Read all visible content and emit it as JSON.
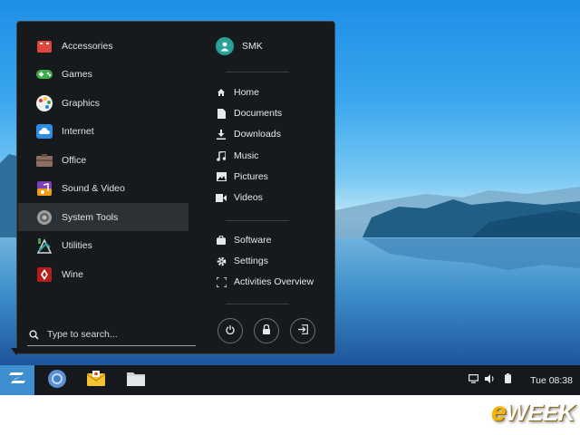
{
  "menu": {
    "categories": [
      {
        "label": "Accessories",
        "icon": "accessories-icon"
      },
      {
        "label": "Games",
        "icon": "games-icon"
      },
      {
        "label": "Graphics",
        "icon": "graphics-icon"
      },
      {
        "label": "Internet",
        "icon": "internet-icon"
      },
      {
        "label": "Office",
        "icon": "office-icon"
      },
      {
        "label": "Sound & Video",
        "icon": "sound-video-icon"
      },
      {
        "label": "System Tools",
        "icon": "system-tools-icon",
        "selected": true
      },
      {
        "label": "Utilities",
        "icon": "utilities-icon"
      },
      {
        "label": "Wine",
        "icon": "wine-icon"
      }
    ],
    "search": {
      "placeholder": "Type to search...",
      "value": ""
    },
    "user": {
      "name": "SMK"
    },
    "places": [
      {
        "label": "Home",
        "icon": "home-icon"
      },
      {
        "label": "Documents",
        "icon": "documents-icon"
      },
      {
        "label": "Downloads",
        "icon": "downloads-icon"
      },
      {
        "label": "Music",
        "icon": "music-icon"
      },
      {
        "label": "Pictures",
        "icon": "pictures-icon"
      },
      {
        "label": "Videos",
        "icon": "videos-icon"
      }
    ],
    "system": [
      {
        "label": "Software",
        "icon": "software-icon"
      },
      {
        "label": "Settings",
        "icon": "settings-icon"
      },
      {
        "label": "Activities Overview",
        "icon": "activities-overview-icon"
      }
    ],
    "power_buttons": [
      "power-icon",
      "lock-icon",
      "logout-icon"
    ]
  },
  "taskbar": {
    "apps": [
      "chromium-icon",
      "mail-icon",
      "files-icon"
    ],
    "tray": [
      "display-icon",
      "volume-icon",
      "battery-icon"
    ],
    "clock": "Tue 08:38"
  },
  "watermark": {
    "e": "e",
    "rest": "WEEK"
  },
  "colors": {
    "menu_bg": "#161a1d",
    "selected_bg": "#2c3136",
    "taskbar_bg": "#15191d",
    "zorin_accent": "#3f8fd0",
    "avatar": "#2aa198"
  }
}
